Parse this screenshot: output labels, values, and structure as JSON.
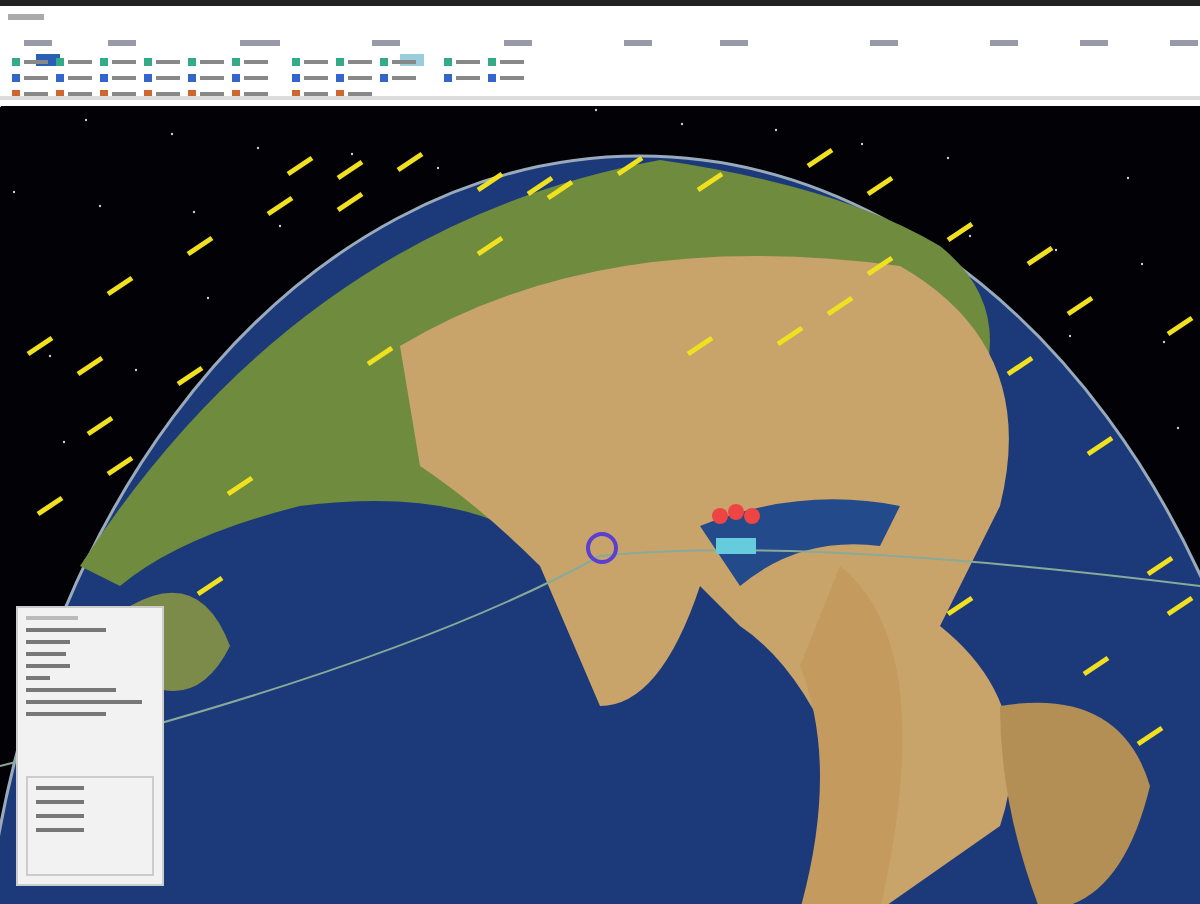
{
  "view": {
    "kind": "globe"
  }
}
